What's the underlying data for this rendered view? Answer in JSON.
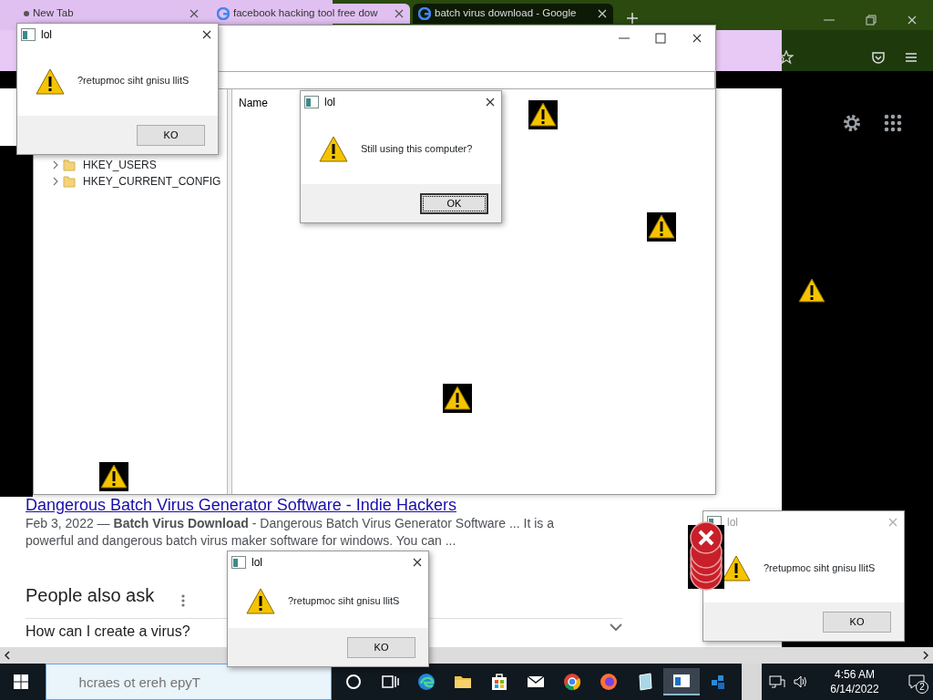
{
  "browser": {
    "tabs": [
      {
        "title": "New Tab",
        "selected": false
      },
      {
        "title": "facebook hacking tool free dow",
        "selected": false
      },
      {
        "title": "batch virus download - Google",
        "selected": true
      }
    ],
    "result": {
      "title": "Dangerous Batch Virus Generator Software - Indie Hackers",
      "snippet": "Feb 3, 2022 — **Batch Virus Download** - Dangerous Batch Virus Generator Software ... It is a powerful and dangerous batch virus maker software for windows. You can ..."
    },
    "people_also_ask": {
      "heading": "People also ask",
      "questions": [
        {
          "text": "How can I create a virus?",
          "expanded": false
        }
      ]
    }
  },
  "registry": {
    "tree": [
      {
        "label": "HKEY_USERS",
        "expanded": false
      },
      {
        "label": "HKEY_CURRENT_CONFIG",
        "expanded": false
      }
    ],
    "columns": [
      "Name"
    ]
  },
  "dialogs": [
    {
      "title": "lol",
      "message": "?retupmoc siht gnisu llitS",
      "button": "KO",
      "active": true,
      "focused": false
    },
    {
      "title": "lol",
      "message": "Still using this computer?",
      "button": "OK",
      "active": true,
      "focused": true
    },
    {
      "title": "lol",
      "message": "?retupmoc siht gnisu llitS",
      "button": "KO",
      "active": true,
      "focused": false
    },
    {
      "title": "lol",
      "message": "?retupmoc siht gnisu llitS",
      "button": "KO",
      "active": false,
      "focused": false
    }
  ],
  "taskbar": {
    "search_placeholder": "hcraes ot ereh epyT",
    "apps": [
      {
        "kind": "cortana",
        "active": false
      },
      {
        "kind": "taskview",
        "active": false
      },
      {
        "kind": "edge",
        "active": false
      },
      {
        "kind": "folder",
        "active": false
      },
      {
        "kind": "store",
        "active": false
      },
      {
        "kind": "mail",
        "active": false
      },
      {
        "kind": "chrome",
        "active": false
      },
      {
        "kind": "firefox",
        "active": false
      },
      {
        "kind": "notepad",
        "active": false
      },
      {
        "kind": "window",
        "active": true
      },
      {
        "kind": "cubes",
        "active": false
      }
    ],
    "time": "4:56 AM",
    "date": "6/14/2022",
    "notifications": "2"
  }
}
